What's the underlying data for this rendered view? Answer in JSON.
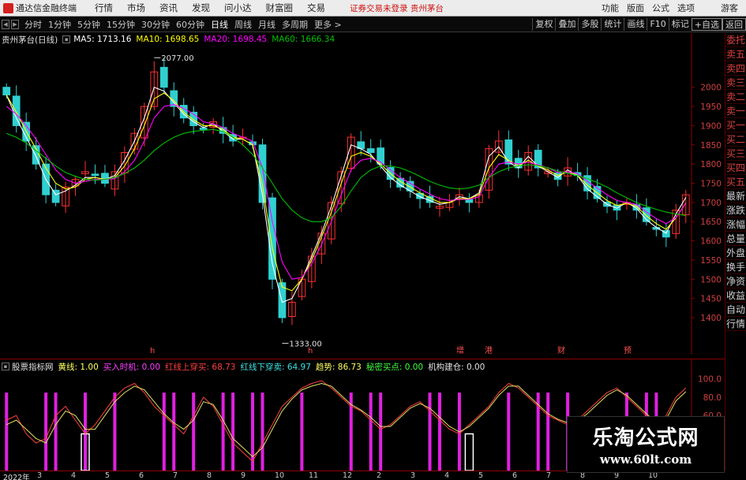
{
  "app": {
    "title": "通达信金融终端"
  },
  "menu": {
    "items": [
      "行情",
      "市场",
      "资讯",
      "发现",
      "问小达",
      "财富圈",
      "交易"
    ],
    "alert": "证券交易未登录  贵州茅台",
    "right_items": [
      "功能",
      "版面",
      "公式",
      "选项"
    ],
    "guest": "游客"
  },
  "toolbar": {
    "periods": [
      "分时",
      "1分钟",
      "5分钟",
      "15分钟",
      "30分钟",
      "60分钟",
      "日线",
      "周线",
      "月线",
      "多周期",
      "更多 >"
    ],
    "active_period": "日线",
    "right_buttons": [
      "复权",
      "叠加",
      "多股",
      "统计",
      "画线",
      "F10",
      "标记",
      "+自选",
      "返回"
    ]
  },
  "info": {
    "stock": "贵州茅台(日线)",
    "ma5": "MA5: 1713.16",
    "ma10": "MA10: 1698.65",
    "ma20": "MA20: 1698.45",
    "ma60": "MA60: 1666.34"
  },
  "indicator": {
    "name": "股票指标网",
    "items": [
      "黄线: 1.00",
      "买入时机: 0.00",
      "红线上穿买: 68.73",
      "红线下穿卖: 64.97",
      "趋势: 86.73",
      "秘密买点: 0.00",
      "机构建仓: 0.00"
    ]
  },
  "sidebar": {
    "items": [
      "委托",
      "卖五",
      "卖四",
      "卖三",
      "卖二",
      "卖一",
      "买一",
      "买二",
      "买三",
      "买四",
      "买五",
      "最新",
      "涨跌",
      "涨幅",
      "总量",
      "外盘",
      "换手",
      "净资",
      "收益",
      "自动",
      "行情"
    ]
  },
  "time_axis": {
    "labels": [
      "2022年",
      "3",
      "4",
      "5",
      "6",
      "7",
      "8",
      "9",
      "10",
      "11",
      "12",
      "2",
      "3",
      "4",
      "5",
      "6",
      "7",
      "8",
      "9",
      "10"
    ]
  },
  "event_markers": [
    {
      "x": 190,
      "t": "h"
    },
    {
      "x": 390,
      "t": "h"
    },
    {
      "x": 578,
      "t": "增"
    },
    {
      "x": 614,
      "t": "港"
    },
    {
      "x": 706,
      "t": "财"
    },
    {
      "x": 790,
      "t": "预"
    }
  ],
  "watermark": {
    "title": "乐淘公式网",
    "url": "www.60lt.com"
  },
  "colors": {
    "ma5": "#ffffff",
    "ma10": "#ffff00",
    "ma20": "#ff00ff",
    "ma60": "#00c000",
    "up": "#ff3030",
    "down": "#30d0d0"
  },
  "chart_data": [
    {
      "type": "candlestick",
      "title": "贵州茅台(日线)",
      "y_ticks": [
        1400,
        1450,
        1500,
        1550,
        1600,
        1650,
        1700,
        1750,
        1800,
        1850,
        1900,
        1950,
        2000
      ],
      "ylim": [
        1320,
        2100
      ],
      "annotations": [
        {
          "label": "2077.00",
          "value": 2077,
          "type": "high"
        },
        {
          "label": "1333.00",
          "value": 1333,
          "type": "low"
        }
      ],
      "series": {
        "close": [
          1980,
          1900,
          1860,
          1800,
          1720,
          1700,
          1740,
          1760,
          1780,
          1770,
          1750,
          1780,
          1830,
          1880,
          1950,
          2040,
          2000,
          1950,
          1920,
          1900,
          1890,
          1910,
          1880,
          1860,
          1870,
          1850,
          1700,
          1500,
          1400,
          1440,
          1500,
          1560,
          1620,
          1700,
          1780,
          1870,
          1840,
          1830,
          1800,
          1760,
          1740,
          1730,
          1710,
          1700,
          1690,
          1700,
          1720,
          1700,
          1720,
          1840,
          1860,
          1800,
          1790,
          1830,
          1790,
          1780,
          1760,
          1790,
          1770,
          1730,
          1710,
          1690,
          1680,
          1700,
          1680,
          1650,
          1630,
          1610,
          1680,
          1720
        ],
        "ma5": [
          1980,
          1920,
          1870,
          1820,
          1760,
          1720,
          1730,
          1745,
          1765,
          1765,
          1760,
          1770,
          1810,
          1860,
          1920,
          2000,
          1990,
          1960,
          1930,
          1910,
          1895,
          1905,
          1885,
          1865,
          1865,
          1850,
          1720,
          1540,
          1440,
          1450,
          1500,
          1560,
          1620,
          1690,
          1770,
          1850,
          1840,
          1825,
          1795,
          1765,
          1745,
          1730,
          1715,
          1705,
          1695,
          1700,
          1715,
          1710,
          1725,
          1820,
          1845,
          1805,
          1790,
          1820,
          1795,
          1780,
          1765,
          1785,
          1770,
          1735,
          1715,
          1695,
          1685,
          1700,
          1685,
          1655,
          1635,
          1620,
          1670,
          1713
        ],
        "ma10": [
          1980,
          1935,
          1885,
          1840,
          1790,
          1750,
          1735,
          1740,
          1760,
          1765,
          1760,
          1765,
          1795,
          1840,
          1900,
          1970,
          1985,
          1965,
          1935,
          1915,
          1900,
          1900,
          1890,
          1870,
          1865,
          1850,
          1745,
          1580,
          1480,
          1470,
          1500,
          1550,
          1610,
          1675,
          1750,
          1820,
          1830,
          1820,
          1800,
          1775,
          1755,
          1740,
          1725,
          1712,
          1700,
          1700,
          1710,
          1710,
          1720,
          1790,
          1825,
          1810,
          1795,
          1810,
          1795,
          1785,
          1770,
          1780,
          1770,
          1745,
          1725,
          1705,
          1692,
          1698,
          1690,
          1665,
          1645,
          1630,
          1660,
          1699
        ],
        "ma20": [
          1950,
          1930,
          1900,
          1865,
          1825,
          1785,
          1760,
          1750,
          1755,
          1760,
          1760,
          1762,
          1780,
          1810,
          1860,
          1920,
          1950,
          1955,
          1945,
          1930,
          1910,
          1905,
          1895,
          1880,
          1870,
          1860,
          1790,
          1650,
          1545,
          1500,
          1505,
          1540,
          1590,
          1650,
          1720,
          1785,
          1810,
          1815,
          1805,
          1785,
          1765,
          1750,
          1735,
          1722,
          1710,
          1705,
          1708,
          1708,
          1715,
          1765,
          1800,
          1805,
          1800,
          1805,
          1798,
          1790,
          1778,
          1780,
          1775,
          1755,
          1738,
          1720,
          1705,
          1700,
          1695,
          1675,
          1658,
          1645,
          1660,
          1698
        ],
        "ma60": [
          1880,
          1870,
          1855,
          1835,
          1815,
          1795,
          1778,
          1768,
          1760,
          1758,
          1760,
          1765,
          1775,
          1790,
          1810,
          1835,
          1855,
          1870,
          1880,
          1885,
          1888,
          1890,
          1885,
          1870,
          1850,
          1825,
          1790,
          1750,
          1710,
          1680,
          1660,
          1650,
          1650,
          1660,
          1690,
          1730,
          1765,
          1785,
          1795,
          1795,
          1790,
          1780,
          1768,
          1755,
          1745,
          1738,
          1735,
          1738,
          1745,
          1765,
          1780,
          1790,
          1795,
          1798,
          1796,
          1790,
          1782,
          1776,
          1770,
          1762,
          1752,
          1740,
          1725,
          1712,
          1700,
          1690,
          1682,
          1675,
          1670,
          1666
        ]
      }
    },
    {
      "type": "line",
      "title": "股票指标网",
      "y_ticks": [
        60,
        80,
        100
      ],
      "ylim": [
        0,
        110
      ],
      "series": [
        {
          "name": "红线",
          "values": [
            55,
            60,
            40,
            30,
            35,
            60,
            70,
            55,
            40,
            50,
            65,
            80,
            90,
            95,
            85,
            70,
            60,
            50,
            40,
            60,
            80,
            70,
            50,
            30,
            20,
            10,
            30,
            50,
            70,
            80,
            90,
            95,
            98,
            90,
            80,
            70,
            65,
            55,
            45,
            50,
            60,
            70,
            75,
            65,
            55,
            45,
            40,
            50,
            60,
            70,
            85,
            95,
            90,
            80,
            70,
            60,
            55,
            50,
            55,
            65,
            75,
            85,
            90,
            80,
            70,
            60,
            50,
            60,
            80,
            90
          ]
        },
        {
          "name": "黄线",
          "values": [
            50,
            55,
            45,
            35,
            30,
            50,
            65,
            60,
            45,
            45,
            60,
            75,
            85,
            92,
            88,
            75,
            62,
            52,
            45,
            55,
            75,
            72,
            55,
            35,
            25,
            15,
            25,
            45,
            65,
            78,
            88,
            92,
            95,
            92,
            82,
            72,
            66,
            58,
            48,
            48,
            58,
            68,
            73,
            68,
            58,
            48,
            42,
            48,
            58,
            68,
            82,
            92,
            92,
            82,
            72,
            62,
            56,
            52,
            54,
            62,
            72,
            82,
            88,
            82,
            72,
            62,
            52,
            56,
            76,
            86
          ]
        },
        {
          "name": "买卖柱",
          "values": [
            1,
            0,
            0,
            0,
            1,
            1,
            0,
            0,
            1,
            0,
            0,
            1,
            0,
            0,
            0,
            0,
            1,
            1,
            0,
            1,
            0,
            0,
            1,
            1,
            0,
            1,
            1,
            0,
            0,
            0,
            1,
            0,
            0,
            0,
            0,
            1,
            0,
            1,
            1,
            0,
            0,
            0,
            0,
            1,
            1,
            0,
            1,
            0,
            0,
            0,
            0,
            1,
            0,
            0,
            1,
            1,
            0,
            1,
            0,
            0,
            0,
            0,
            0,
            1,
            0,
            1,
            1,
            0,
            0,
            0
          ]
        }
      ]
    }
  ]
}
